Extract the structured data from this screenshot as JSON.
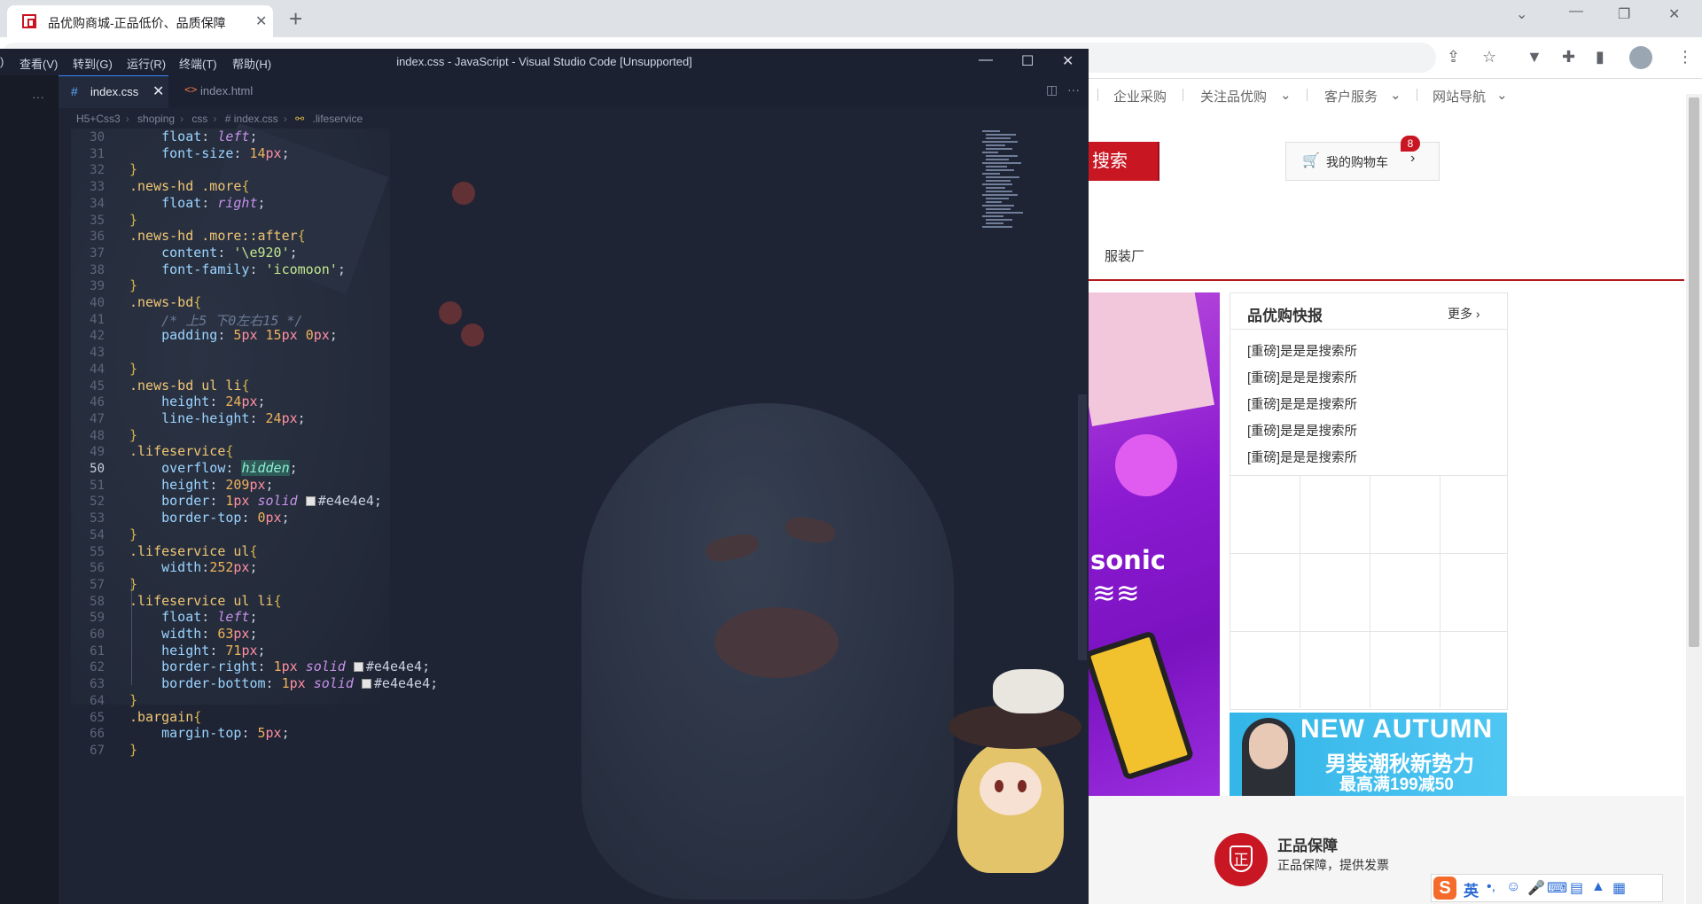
{
  "browser": {
    "tab_title": "品优购商城-正品低价、品质保障",
    "new_tab": "+",
    "close_tab": "✕"
  },
  "shortcut": {
    "items": [
      "企业采购",
      "关注品优购",
      "客户服务",
      "网站导航"
    ]
  },
  "search": {
    "button_label": "搜索"
  },
  "cart": {
    "label": "我的购物车",
    "count": "8"
  },
  "nav": {
    "link": "服装厂"
  },
  "banner": {
    "text": "sonic",
    "waves": "≋≋"
  },
  "news": {
    "title": "品优购快报",
    "more": "更多",
    "items": [
      "[重磅]是是是搜索所",
      "[重磅]是是是搜索所",
      "[重磅]是是是搜索所",
      "[重磅]是是是搜索所",
      "[重磅]是是是搜索所"
    ]
  },
  "autumn_ad": {
    "line1": "NEW AUTUMN",
    "line2": "男装潮秋新势力",
    "line3": "最高满199减50"
  },
  "guarantee": {
    "icon_char": "正",
    "title": "正品保障",
    "desc": "正品保障，提供发票"
  },
  "ime": {
    "logo": "S",
    "lang": "英"
  },
  "vscode": {
    "menu": [
      ")",
      "查看(V)",
      "转到(G)",
      "运行(R)",
      "终端(T)",
      "帮助(H)"
    ],
    "window_title": "index.css - JavaScript - Visual Studio Code [Unsupported]",
    "tabs": [
      {
        "name": "index.css",
        "icon": "#"
      },
      {
        "name": "index.html",
        "icon": "<>"
      }
    ],
    "breadcrumb": [
      "H5+Css3",
      "shoping",
      "css",
      "# index.css",
      ".lifeservice"
    ],
    "current_line": 50,
    "lines": [
      {
        "n": 30,
        "t": [
          [
            "    ",
            ""
          ],
          [
            "float",
            "prop"
          ],
          [
            ": ",
            ""
          ],
          [
            "left",
            "kw"
          ],
          [
            ";",
            ""
          ]
        ]
      },
      {
        "n": 31,
        "t": [
          [
            "    ",
            ""
          ],
          [
            "font-size",
            "prop"
          ],
          [
            ": ",
            ""
          ],
          [
            "14",
            "val"
          ],
          [
            "px",
            "unit"
          ],
          [
            ";",
            ""
          ]
        ]
      },
      {
        "n": 32,
        "t": [
          [
            "}",
            "br"
          ]
        ]
      },
      {
        "n": 33,
        "t": [
          [
            ".news-hd .more",
            "sel"
          ],
          [
            "{",
            "br"
          ]
        ]
      },
      {
        "n": 34,
        "t": [
          [
            "    ",
            ""
          ],
          [
            "float",
            "prop"
          ],
          [
            ": ",
            ""
          ],
          [
            "right",
            "kw"
          ],
          [
            ";",
            ""
          ]
        ]
      },
      {
        "n": 35,
        "t": [
          [
            "}",
            "br"
          ]
        ]
      },
      {
        "n": 36,
        "t": [
          [
            ".news-hd .more::after",
            "sel"
          ],
          [
            "{",
            "br"
          ]
        ]
      },
      {
        "n": 37,
        "t": [
          [
            "    ",
            ""
          ],
          [
            "content",
            "prop"
          ],
          [
            ": ",
            ""
          ],
          [
            "'\\e920'",
            "str"
          ],
          [
            ";",
            ""
          ]
        ]
      },
      {
        "n": 38,
        "t": [
          [
            "    ",
            ""
          ],
          [
            "font-family",
            "prop"
          ],
          [
            ": ",
            ""
          ],
          [
            "'icomoon'",
            "str"
          ],
          [
            ";",
            ""
          ]
        ]
      },
      {
        "n": 39,
        "t": [
          [
            "}",
            "br"
          ]
        ]
      },
      {
        "n": 40,
        "t": [
          [
            ".news-bd",
            "sel"
          ],
          [
            "{",
            "br"
          ]
        ]
      },
      {
        "n": 41,
        "t": [
          [
            "    ",
            ""
          ],
          [
            "/* 上5 下0左右15 */",
            "cm"
          ]
        ]
      },
      {
        "n": 42,
        "t": [
          [
            "    ",
            ""
          ],
          [
            "padding",
            "prop"
          ],
          [
            ": ",
            ""
          ],
          [
            "5",
            "val"
          ],
          [
            "px",
            "unit"
          ],
          [
            " ",
            ""
          ],
          [
            "15",
            "val"
          ],
          [
            "px",
            "unit"
          ],
          [
            " ",
            ""
          ],
          [
            "0",
            "val"
          ],
          [
            "px",
            "unit"
          ],
          [
            ";",
            ""
          ]
        ]
      },
      {
        "n": 43,
        "t": []
      },
      {
        "n": 44,
        "t": [
          [
            "}",
            "br"
          ]
        ]
      },
      {
        "n": 45,
        "t": [
          [
            ".news-bd ul li",
            "sel"
          ],
          [
            "{",
            "br"
          ]
        ]
      },
      {
        "n": 46,
        "t": [
          [
            "    ",
            ""
          ],
          [
            "height",
            "prop"
          ],
          [
            ": ",
            ""
          ],
          [
            "24",
            "val"
          ],
          [
            "px",
            "unit"
          ],
          [
            ";",
            ""
          ]
        ]
      },
      {
        "n": 47,
        "t": [
          [
            "    ",
            ""
          ],
          [
            "line-height",
            "prop"
          ],
          [
            ": ",
            ""
          ],
          [
            "24",
            "val"
          ],
          [
            "px",
            "unit"
          ],
          [
            ";",
            ""
          ]
        ]
      },
      {
        "n": 48,
        "t": [
          [
            "}",
            "br"
          ]
        ]
      },
      {
        "n": 49,
        "t": [
          [
            ".lifeservice",
            "sel"
          ],
          [
            "{",
            "br"
          ]
        ]
      },
      {
        "n": 50,
        "t": [
          [
            "    ",
            ""
          ],
          [
            "overflow",
            "prop"
          ],
          [
            ": ",
            ""
          ],
          [
            "hidden",
            "hl"
          ],
          [
            ";",
            ""
          ]
        ]
      },
      {
        "n": 51,
        "t": [
          [
            "    ",
            ""
          ],
          [
            "height",
            "prop"
          ],
          [
            ": ",
            ""
          ],
          [
            "209",
            "val"
          ],
          [
            "px",
            "unit"
          ],
          [
            ";",
            ""
          ]
        ]
      },
      {
        "n": 52,
        "t": [
          [
            "    ",
            ""
          ],
          [
            "border",
            "prop"
          ],
          [
            ": ",
            ""
          ],
          [
            "1",
            "val"
          ],
          [
            "px",
            "unit"
          ],
          [
            " ",
            ""
          ],
          [
            "solid",
            "kw"
          ],
          [
            " ",
            ""
          ],
          [
            "#e4e4e4",
            "swatch"
          ],
          [
            ";",
            ""
          ]
        ]
      },
      {
        "n": 53,
        "t": [
          [
            "    ",
            ""
          ],
          [
            "border-top",
            "prop"
          ],
          [
            ": ",
            ""
          ],
          [
            "0",
            "val"
          ],
          [
            "px",
            "unit"
          ],
          [
            ";",
            ""
          ]
        ]
      },
      {
        "n": 54,
        "t": [
          [
            "}",
            "br"
          ]
        ]
      },
      {
        "n": 55,
        "t": [
          [
            ".lifeservice ul",
            "sel"
          ],
          [
            "{",
            "br"
          ]
        ]
      },
      {
        "n": 56,
        "t": [
          [
            "    ",
            ""
          ],
          [
            "width",
            "prop"
          ],
          [
            ":",
            ""
          ],
          [
            "252",
            "val"
          ],
          [
            "px",
            "unit"
          ],
          [
            ";",
            ""
          ]
        ]
      },
      {
        "n": 57,
        "t": [
          [
            "}",
            "br"
          ]
        ]
      },
      {
        "n": 58,
        "t": [
          [
            ".lifeservice ul li",
            "sel"
          ],
          [
            "{",
            "br"
          ]
        ]
      },
      {
        "n": 59,
        "t": [
          [
            "    ",
            ""
          ],
          [
            "float",
            "prop"
          ],
          [
            ": ",
            ""
          ],
          [
            "left",
            "kw"
          ],
          [
            ";",
            ""
          ]
        ]
      },
      {
        "n": 60,
        "t": [
          [
            "    ",
            ""
          ],
          [
            "width",
            "prop"
          ],
          [
            ": ",
            ""
          ],
          [
            "63",
            "val"
          ],
          [
            "px",
            "unit"
          ],
          [
            ";",
            ""
          ]
        ]
      },
      {
        "n": 61,
        "t": [
          [
            "    ",
            ""
          ],
          [
            "height",
            "prop"
          ],
          [
            ": ",
            ""
          ],
          [
            "71",
            "val"
          ],
          [
            "px",
            "unit"
          ],
          [
            ";",
            ""
          ]
        ]
      },
      {
        "n": 62,
        "t": [
          [
            "    ",
            ""
          ],
          [
            "border-right",
            "prop"
          ],
          [
            ": ",
            ""
          ],
          [
            "1",
            "val"
          ],
          [
            "px",
            "unit"
          ],
          [
            " ",
            ""
          ],
          [
            "solid",
            "kw"
          ],
          [
            " ",
            ""
          ],
          [
            "#e4e4e4",
            "swatch"
          ],
          [
            ";",
            ""
          ]
        ]
      },
      {
        "n": 63,
        "t": [
          [
            "    ",
            ""
          ],
          [
            "border-bottom",
            "prop"
          ],
          [
            ": ",
            ""
          ],
          [
            "1",
            "val"
          ],
          [
            "px",
            "unit"
          ],
          [
            " ",
            ""
          ],
          [
            "solid",
            "kw"
          ],
          [
            " ",
            ""
          ],
          [
            "#e4e4e4",
            "swatch"
          ],
          [
            ";",
            ""
          ]
        ]
      },
      {
        "n": 64,
        "t": [
          [
            "}",
            "br"
          ]
        ]
      },
      {
        "n": 65,
        "t": [
          [
            ".bargain",
            "sel"
          ],
          [
            "{",
            "br"
          ]
        ]
      },
      {
        "n": 66,
        "t": [
          [
            "    ",
            ""
          ],
          [
            "margin-top",
            "prop"
          ],
          [
            ": ",
            ""
          ],
          [
            "5",
            "val"
          ],
          [
            "px",
            "unit"
          ],
          [
            ";",
            ""
          ]
        ]
      },
      {
        "n": 67,
        "t": [
          [
            "}",
            "br"
          ]
        ]
      }
    ]
  },
  "colors": {
    "brand_red": "#c81623",
    "editor_bg": "#1e2433",
    "border_gray": "#e4e4e4"
  }
}
